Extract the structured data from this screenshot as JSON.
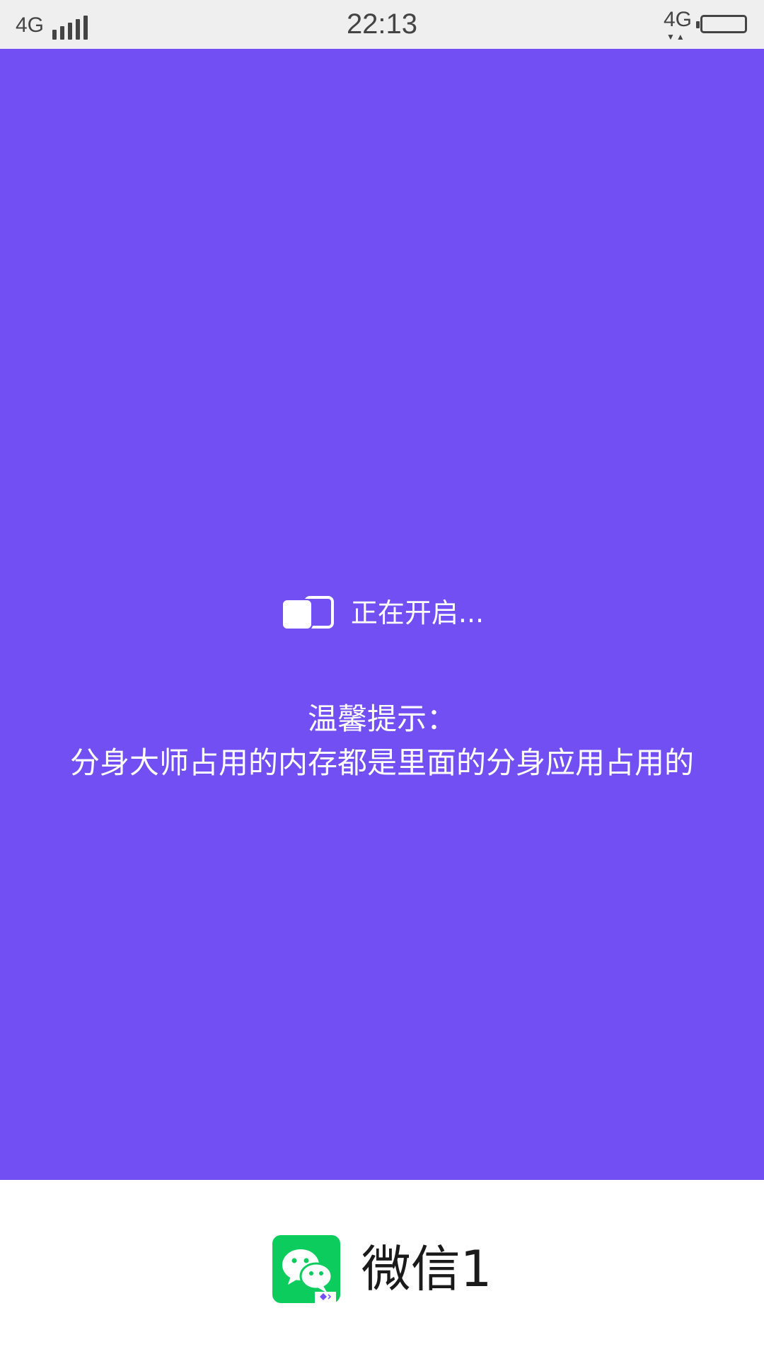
{
  "status_bar": {
    "network_left": "4G",
    "time": "22:13",
    "network_right": "4G",
    "signal_icon": "signal-bars-icon",
    "battery_icon": "battery-full-icon"
  },
  "splash": {
    "background_color": "#724ff3",
    "loading_icon": "dual-window-icon",
    "loading_text": "正在开启...",
    "tip_title": "温馨提示：",
    "tip_body": "分身大师占用的内存都是里面的分身应用占用的"
  },
  "app": {
    "icon": "wechat-icon",
    "name": "微信1",
    "accent_color": "#0ccc5d"
  }
}
